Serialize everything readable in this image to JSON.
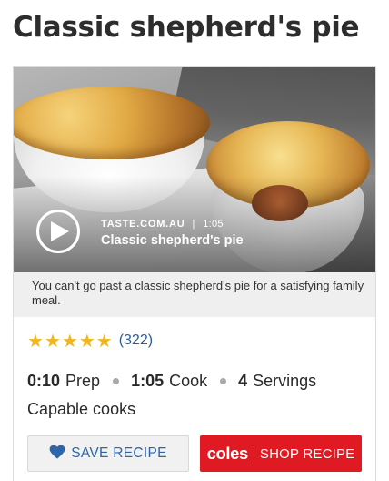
{
  "page": {
    "title": "Classic shepherd's pie"
  },
  "video": {
    "source": "TASTE.COM.AU",
    "separator": "|",
    "duration": "1:05",
    "title": "Classic shepherd's pie",
    "play_icon": "play-icon"
  },
  "recipe": {
    "description": "You can't go past a classic shepherd's pie for a satisfying family meal.",
    "rating": {
      "stars": 5,
      "star_glyph": "★",
      "count_label": "(322)",
      "star_color": "#f2b51f"
    },
    "prep": {
      "time": "0:10",
      "label": "Prep"
    },
    "cook": {
      "time": "1:05",
      "label": "Cook"
    },
    "servings": {
      "count": "4",
      "label": "Servings"
    },
    "difficulty": "Capable cooks"
  },
  "actions": {
    "save": {
      "label": "SAVE RECIPE",
      "icon": "heart-icon",
      "color": "#2f65a8"
    },
    "shop": {
      "brand": "coles",
      "label": "SHOP RECIPE",
      "color": "#e01a22"
    }
  }
}
